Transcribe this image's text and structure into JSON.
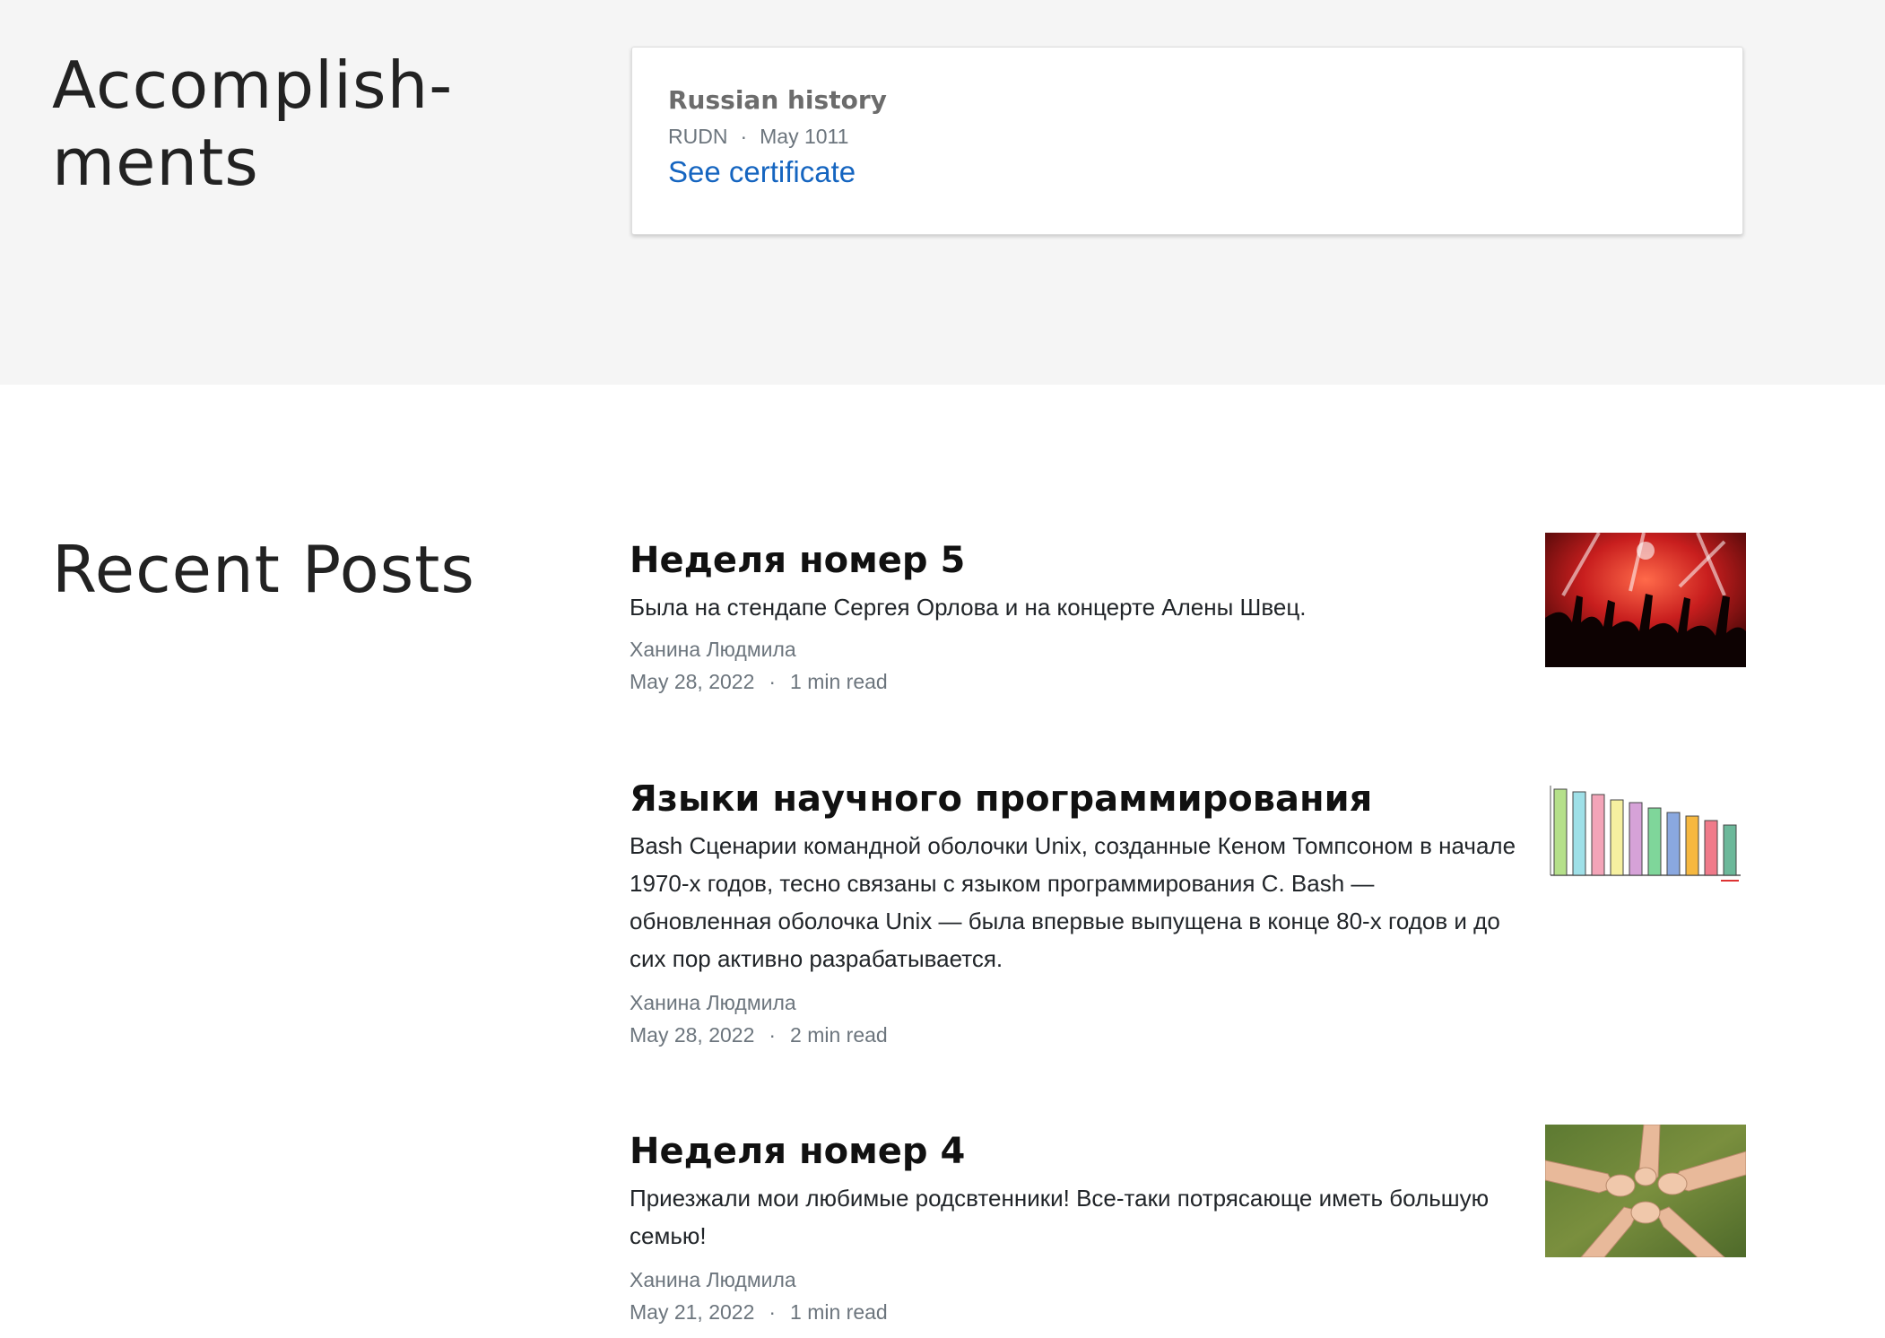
{
  "accomplishments": {
    "title": "Accomplish-ments",
    "title_line1": "Accomplish-",
    "title_line2": "ments",
    "certificate": {
      "name": "Russian history",
      "issuer": "RUDN",
      "separator": "·",
      "date": "May 1011",
      "link_label": "See certificate"
    }
  },
  "recent_posts": {
    "title": "Recent Posts",
    "posts": [
      {
        "title": "Неделя номер 5",
        "excerpt": "Была на стендапе Сергея Орлова и на концерте Алены Швец.",
        "author": "Ханина Людмила",
        "date": "May 28, 2022",
        "separator": "·",
        "read_time": "1 min read",
        "thumbnail": "concert-crowd-image"
      },
      {
        "title": "Языки научного программирования",
        "excerpt": "Bash Сценарии командной оболочки Unix, созданные Кеном Томпсоном в начале 1970-х годов, тесно связаны с языком программирования C. Bash — обновленная оболочка Unix — была впервые выпущена в конце 80-х годов и до сих пор активно разрабатывается.",
        "author": "Ханина Людмила",
        "date": "May 28, 2022",
        "separator": "·",
        "read_time": "2 min read",
        "thumbnail": "programming-languages-bar-chart-image"
      },
      {
        "title": "Неделя номер 4",
        "excerpt": "Приезжали мои любимые родсвтенники! Все-таки потрясающе иметь большую семью!",
        "author": "Ханина Людмила",
        "date": "May 21, 2022",
        "separator": "·",
        "read_time": "1 min read",
        "thumbnail": "joined-hands-image"
      }
    ]
  },
  "colors": {
    "accomplishments_bg": "#f5f5f5",
    "link": "#1565c0",
    "muted_text": "#6c757d"
  }
}
